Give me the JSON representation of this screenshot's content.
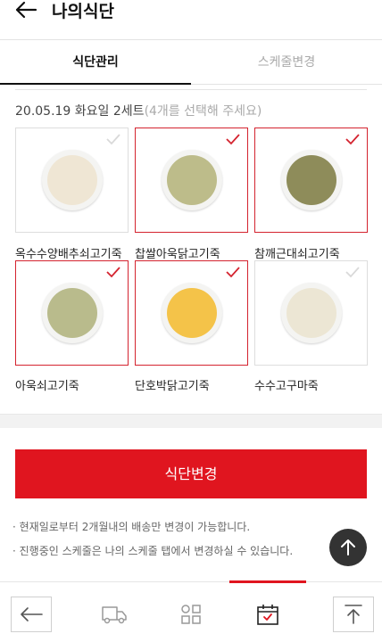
{
  "header": {
    "title": "나의식단",
    "back_icon": "arrow-left-icon"
  },
  "tabs": [
    {
      "label": "식단관리",
      "active": true
    },
    {
      "label": "스케줄변경",
      "active": false
    }
  ],
  "selection": {
    "date": "20.05.19",
    "weekday": "화요일",
    "set": "2세트",
    "hint": "(4개를 선택해 주세요)"
  },
  "menu_items": [
    {
      "name": "옥수수양배추쇠고기죽",
      "selected": false,
      "porridge_color": "#efe6d4"
    },
    {
      "name": "찹쌀아욱닭고기죽",
      "selected": true,
      "porridge_color": "#bdbc8a"
    },
    {
      "name": "참깨근대쇠고기죽",
      "selected": true,
      "porridge_color": "#8e8c5a"
    },
    {
      "name": "아욱쇠고기죽",
      "selected": true,
      "porridge_color": "#b9bb8c"
    },
    {
      "name": "단호박닭고기죽",
      "selected": true,
      "porridge_color": "#f4c349"
    },
    {
      "name": "수수고구마죽",
      "selected": false,
      "porridge_color": "#ece6d4"
    }
  ],
  "actions": {
    "change_diet_label": "식단변경"
  },
  "notes": [
    "현재일로부터 2개월내의 배송만 변경이 가능합니다.",
    "진행중인 스케줄은 나의 스케줄 탭에서 변경하실 수 있습니다."
  ],
  "bottom_nav": [
    {
      "icon": "arrow-left-icon"
    },
    {
      "icon": "truck-icon"
    },
    {
      "icon": "grid-icon"
    },
    {
      "icon": "calendar-check-icon",
      "active": true
    },
    {
      "icon": "scroll-top-icon"
    }
  ],
  "colors": {
    "accent": "#e0151f",
    "selected_border": "#d4232f",
    "fab": "#333333"
  }
}
